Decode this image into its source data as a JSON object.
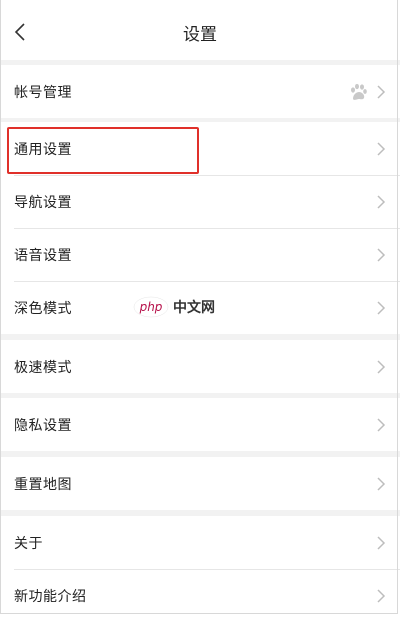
{
  "header": {
    "title": "设置",
    "back_icon": "chevron-left-icon"
  },
  "groups": [
    {
      "items": [
        {
          "label": "帐号管理",
          "trailing_icon": "paw-icon"
        }
      ]
    },
    {
      "items": [
        {
          "label": "通用设置",
          "highlighted": true
        },
        {
          "label": "导航设置"
        },
        {
          "label": "语音设置"
        },
        {
          "label": "深色模式"
        }
      ]
    },
    {
      "items": [
        {
          "label": "极速模式"
        }
      ]
    },
    {
      "items": [
        {
          "label": "隐私设置"
        }
      ]
    },
    {
      "items": [
        {
          "label": "重置地图"
        }
      ]
    },
    {
      "items": [
        {
          "label": "关于"
        },
        {
          "label": "新功能介绍"
        }
      ]
    }
  ],
  "watermark": {
    "logo": "php",
    "text": "中文网"
  },
  "colors": {
    "highlight": "#e0302a",
    "watermark_accent": "#b7124b",
    "chevron": "#bdbdbd"
  }
}
